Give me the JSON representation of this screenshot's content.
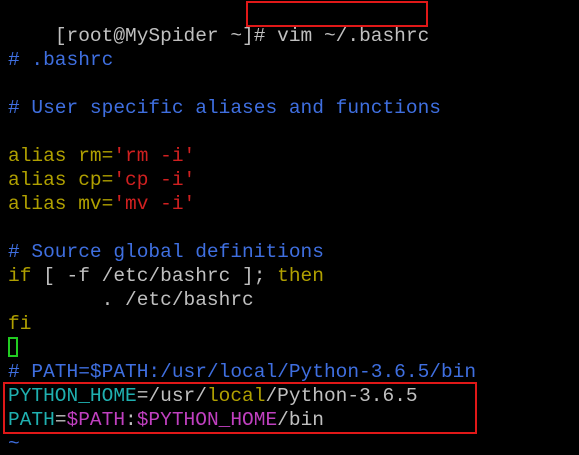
{
  "prompt": {
    "user_host": "[root@MySpider ~]#",
    "command": "vim ~/.bashrc"
  },
  "file": {
    "line_bashrc_comment": "# .bashrc",
    "line_user_aliases_comment": "# User specific aliases and functions",
    "aliases": [
      {
        "kw": "alias",
        "name": " rm=",
        "value": "'rm -i'"
      },
      {
        "kw": "alias",
        "name": " cp=",
        "value": "'cp -i'"
      },
      {
        "kw": "alias",
        "name": " mv=",
        "value": "'mv -i'"
      }
    ],
    "line_source_comment": "# Source global definitions",
    "if_kw": "if",
    "if_cond": " [ -f /etc/bashrc ]; ",
    "then_kw": "then",
    "source_line": "        . /etc/bashrc",
    "fi_kw": "fi",
    "path_comment": "# PATH=$PATH:/usr/local/Python-3.6.5/bin",
    "python_home": {
      "name": "PYTHON_HOME",
      "eq": "=/usr/",
      "local": "local",
      "rest": "/Python-3.6.5"
    },
    "path_line": {
      "name": "PATH",
      "eq": "=",
      "var1": "$PATH",
      "colon": ":",
      "var2": "$PYTHON_HOME",
      "rest": "/bin"
    },
    "tilde": "~"
  },
  "colors": {
    "comment": "#3f6fe0",
    "keyword": "#b0a000",
    "string": "#d02020",
    "variable": "#c040c0",
    "identifier": "#1fb0b0",
    "highlight_box": "#e01818",
    "cursor": "#22cc22"
  }
}
